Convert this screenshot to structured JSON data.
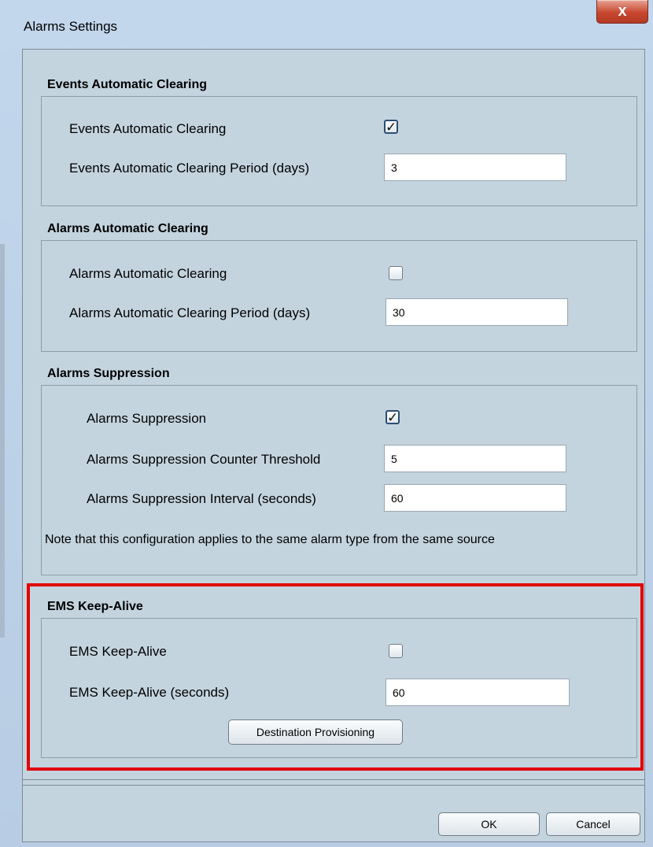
{
  "window": {
    "title": "Alarms Settings",
    "close_label": "x"
  },
  "events_clearing": {
    "section_title": "Events Automatic Clearing",
    "enable_label": "Events Automatic Clearing",
    "enabled": true,
    "period_label": "Events Automatic Clearing Period (days)",
    "period_value": "3"
  },
  "alarms_clearing": {
    "section_title": "Alarms Automatic Clearing",
    "enable_label": "Alarms Automatic Clearing",
    "enabled": false,
    "period_label": "Alarms Automatic Clearing Period (days)",
    "period_value": "30"
  },
  "alarms_suppression": {
    "section_title": "Alarms Suppression",
    "enable_label": "Alarms Suppression",
    "enabled": true,
    "threshold_label": "Alarms Suppression Counter Threshold",
    "threshold_value": "5",
    "interval_label": "Alarms Suppression Interval (seconds)",
    "interval_value": "60",
    "note": "Note that this configuration applies to the same alarm type from the same source"
  },
  "keep_alive": {
    "section_title": "EMS Keep-Alive",
    "enable_label": "EMS Keep-Alive",
    "enabled": false,
    "seconds_label": "EMS Keep-Alive (seconds)",
    "seconds_value": "60",
    "provisioning_button": "Destination Provisioning"
  },
  "footer": {
    "ok_label": "OK",
    "cancel_label": "Cancel"
  },
  "colors": {
    "highlight": "#e10000",
    "close_button": "#c8472f"
  }
}
